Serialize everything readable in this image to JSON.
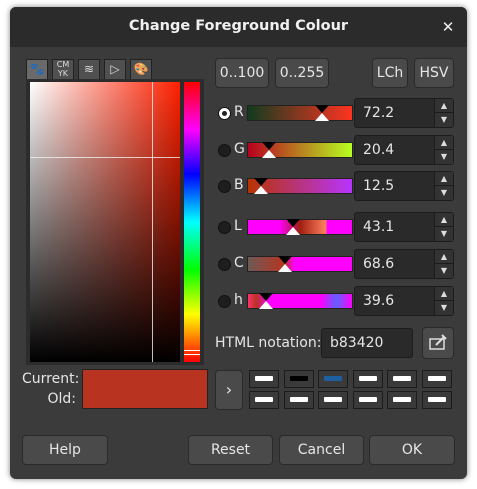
{
  "dialog": {
    "title": "Change Foreground Colour"
  },
  "tabs": [
    "wilber-icon",
    "cmyk-icon",
    "watercolor-icon",
    "triangle-icon",
    "palette-icon"
  ],
  "range_buttons": [
    "0..100",
    "0..255"
  ],
  "model_buttons": [
    "LCh",
    "HSV"
  ],
  "channels": [
    {
      "label": "R",
      "value": "72.2"
    },
    {
      "label": "G",
      "value": "20.4"
    },
    {
      "label": "B",
      "value": "12.5"
    },
    {
      "label": "L",
      "value": "43.1"
    },
    {
      "label": "C",
      "value": "68.6"
    },
    {
      "label": "h",
      "value": "39.6"
    }
  ],
  "html_notation": {
    "label": "HTML notation:",
    "value": "b83420"
  },
  "preview": {
    "current_label": "Current:",
    "old_label": "Old:",
    "current_color": "#b83420",
    "old_color": "#b83420"
  },
  "history": [
    "#ffffff",
    "#000000",
    "#1f5fa0",
    "#ffffff",
    "#ffffff",
    "#ffffff",
    "#ffffff",
    "#ffffff",
    "#ffffff",
    "#ffffff",
    "#ffffff",
    "#ffffff"
  ],
  "buttons": {
    "help": "Help",
    "reset": "Reset",
    "cancel": "Cancel",
    "ok": "OK"
  }
}
